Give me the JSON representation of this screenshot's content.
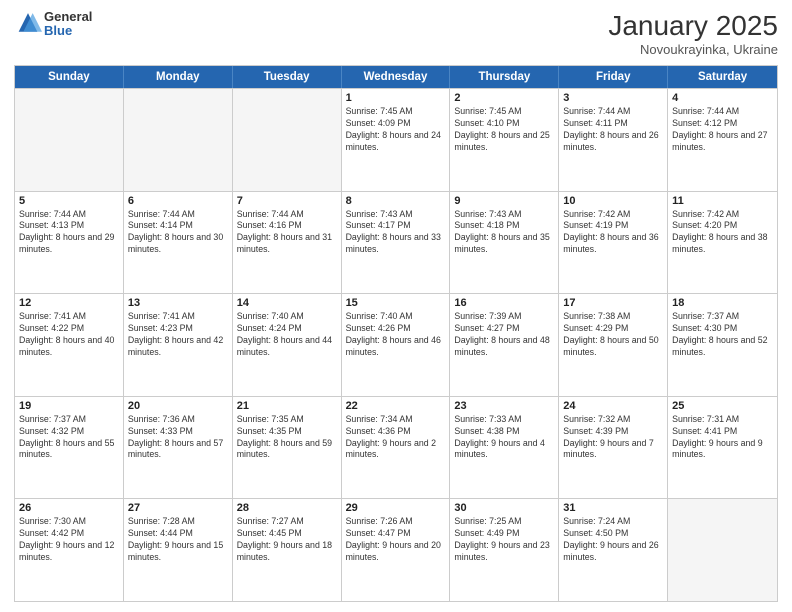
{
  "header": {
    "logo_general": "General",
    "logo_blue": "Blue",
    "month_title": "January 2025",
    "location": "Novoukrayinka, Ukraine"
  },
  "days_of_week": [
    "Sunday",
    "Monday",
    "Tuesday",
    "Wednesday",
    "Thursday",
    "Friday",
    "Saturday"
  ],
  "weeks": [
    [
      {
        "empty": true
      },
      {
        "empty": true
      },
      {
        "empty": true
      },
      {
        "day": 1,
        "sunrise": "7:45 AM",
        "sunset": "4:09 PM",
        "daylight": "8 hours and 24 minutes."
      },
      {
        "day": 2,
        "sunrise": "7:45 AM",
        "sunset": "4:10 PM",
        "daylight": "8 hours and 25 minutes."
      },
      {
        "day": 3,
        "sunrise": "7:44 AM",
        "sunset": "4:11 PM",
        "daylight": "8 hours and 26 minutes."
      },
      {
        "day": 4,
        "sunrise": "7:44 AM",
        "sunset": "4:12 PM",
        "daylight": "8 hours and 27 minutes."
      }
    ],
    [
      {
        "day": 5,
        "sunrise": "7:44 AM",
        "sunset": "4:13 PM",
        "daylight": "8 hours and 29 minutes."
      },
      {
        "day": 6,
        "sunrise": "7:44 AM",
        "sunset": "4:14 PM",
        "daylight": "8 hours and 30 minutes."
      },
      {
        "day": 7,
        "sunrise": "7:44 AM",
        "sunset": "4:16 PM",
        "daylight": "8 hours and 31 minutes."
      },
      {
        "day": 8,
        "sunrise": "7:43 AM",
        "sunset": "4:17 PM",
        "daylight": "8 hours and 33 minutes."
      },
      {
        "day": 9,
        "sunrise": "7:43 AM",
        "sunset": "4:18 PM",
        "daylight": "8 hours and 35 minutes."
      },
      {
        "day": 10,
        "sunrise": "7:42 AM",
        "sunset": "4:19 PM",
        "daylight": "8 hours and 36 minutes."
      },
      {
        "day": 11,
        "sunrise": "7:42 AM",
        "sunset": "4:20 PM",
        "daylight": "8 hours and 38 minutes."
      }
    ],
    [
      {
        "day": 12,
        "sunrise": "7:41 AM",
        "sunset": "4:22 PM",
        "daylight": "8 hours and 40 minutes."
      },
      {
        "day": 13,
        "sunrise": "7:41 AM",
        "sunset": "4:23 PM",
        "daylight": "8 hours and 42 minutes."
      },
      {
        "day": 14,
        "sunrise": "7:40 AM",
        "sunset": "4:24 PM",
        "daylight": "8 hours and 44 minutes."
      },
      {
        "day": 15,
        "sunrise": "7:40 AM",
        "sunset": "4:26 PM",
        "daylight": "8 hours and 46 minutes."
      },
      {
        "day": 16,
        "sunrise": "7:39 AM",
        "sunset": "4:27 PM",
        "daylight": "8 hours and 48 minutes."
      },
      {
        "day": 17,
        "sunrise": "7:38 AM",
        "sunset": "4:29 PM",
        "daylight": "8 hours and 50 minutes."
      },
      {
        "day": 18,
        "sunrise": "7:37 AM",
        "sunset": "4:30 PM",
        "daylight": "8 hours and 52 minutes."
      }
    ],
    [
      {
        "day": 19,
        "sunrise": "7:37 AM",
        "sunset": "4:32 PM",
        "daylight": "8 hours and 55 minutes."
      },
      {
        "day": 20,
        "sunrise": "7:36 AM",
        "sunset": "4:33 PM",
        "daylight": "8 hours and 57 minutes."
      },
      {
        "day": 21,
        "sunrise": "7:35 AM",
        "sunset": "4:35 PM",
        "daylight": "8 hours and 59 minutes."
      },
      {
        "day": 22,
        "sunrise": "7:34 AM",
        "sunset": "4:36 PM",
        "daylight": "9 hours and 2 minutes."
      },
      {
        "day": 23,
        "sunrise": "7:33 AM",
        "sunset": "4:38 PM",
        "daylight": "9 hours and 4 minutes."
      },
      {
        "day": 24,
        "sunrise": "7:32 AM",
        "sunset": "4:39 PM",
        "daylight": "9 hours and 7 minutes."
      },
      {
        "day": 25,
        "sunrise": "7:31 AM",
        "sunset": "4:41 PM",
        "daylight": "9 hours and 9 minutes."
      }
    ],
    [
      {
        "day": 26,
        "sunrise": "7:30 AM",
        "sunset": "4:42 PM",
        "daylight": "9 hours and 12 minutes."
      },
      {
        "day": 27,
        "sunrise": "7:28 AM",
        "sunset": "4:44 PM",
        "daylight": "9 hours and 15 minutes."
      },
      {
        "day": 28,
        "sunrise": "7:27 AM",
        "sunset": "4:45 PM",
        "daylight": "9 hours and 18 minutes."
      },
      {
        "day": 29,
        "sunrise": "7:26 AM",
        "sunset": "4:47 PM",
        "daylight": "9 hours and 20 minutes."
      },
      {
        "day": 30,
        "sunrise": "7:25 AM",
        "sunset": "4:49 PM",
        "daylight": "9 hours and 23 minutes."
      },
      {
        "day": 31,
        "sunrise": "7:24 AM",
        "sunset": "4:50 PM",
        "daylight": "9 hours and 26 minutes."
      },
      {
        "empty": true
      }
    ]
  ]
}
